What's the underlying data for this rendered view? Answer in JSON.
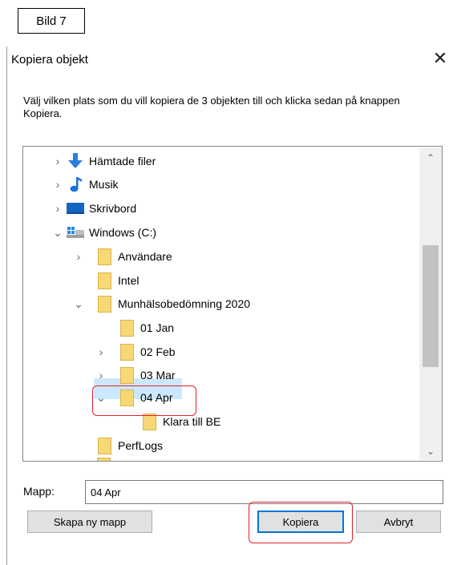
{
  "caption": "Bild 7",
  "dialog": {
    "title": "Kopiera objekt",
    "close_glyph": "✕",
    "instruction": "Välj vilken plats som du vill kopiera de 3 objekten till och klicka sedan på knappen Kopiera."
  },
  "tree": {
    "items": [
      {
        "label": "Hämtade filer",
        "icon": "download-arrow-icon",
        "chevron": "›",
        "depth": 0
      },
      {
        "label": "Musik",
        "icon": "music-note-icon",
        "chevron": "›",
        "depth": 0
      },
      {
        "label": "Skrivbord",
        "icon": "desktop-icon",
        "chevron": "›",
        "depth": 0
      },
      {
        "label": "Windows (C:)",
        "icon": "drive-icon",
        "chevron": "⌄",
        "depth": 0
      },
      {
        "label": "Användare",
        "icon": "folder-icon",
        "chevron": "›",
        "depth": 1
      },
      {
        "label": "Intel",
        "icon": "folder-icon",
        "chevron": "",
        "depth": 1
      },
      {
        "label": "Munhälsobedömning 2020",
        "icon": "folder-icon",
        "chevron": "⌄",
        "depth": 1
      },
      {
        "label": "01 Jan",
        "icon": "folder-icon",
        "chevron": "",
        "depth": 2
      },
      {
        "label": "02 Feb",
        "icon": "folder-icon",
        "chevron": "›",
        "depth": 2
      },
      {
        "label": "03 Mar",
        "icon": "folder-icon",
        "chevron": "›",
        "depth": 2
      },
      {
        "label": "04 Apr",
        "icon": "folder-icon",
        "chevron": "⌄",
        "depth": 2,
        "selected": true
      },
      {
        "label": "Klara till BE",
        "icon": "folder-icon",
        "chevron": "",
        "depth": 3
      },
      {
        "label": "PerfLogs",
        "icon": "folder-icon",
        "chevron": "",
        "depth": 1
      }
    ],
    "scroll_up": "⌃",
    "scroll_down": "⌄"
  },
  "folder_field": {
    "label": "Mapp:",
    "value": "04 Apr"
  },
  "buttons": {
    "new_folder": "Skapa ny mapp",
    "copy": "Kopiera",
    "cancel": "Avbryt"
  },
  "colors": {
    "selection": "#cce8ff",
    "highlight_outline": "#e0202a",
    "primary_border": "#0078d7",
    "folder": "#f8d775"
  }
}
